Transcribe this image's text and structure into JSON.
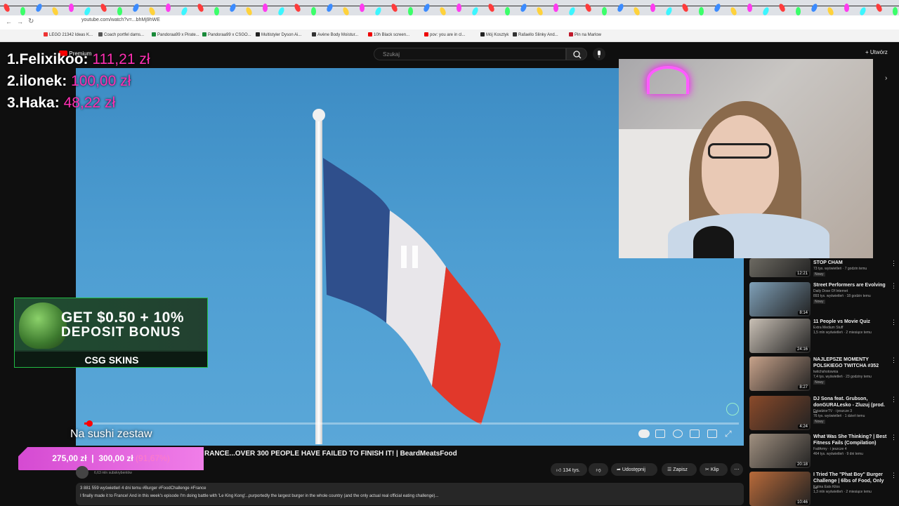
{
  "browser": {
    "url": "youtube.com/watch?v=...bhMj9hWE",
    "bookmarks": [
      {
        "label": "LEGO 21342 Ideas K...",
        "color": "#e33"
      },
      {
        "label": "Coach portfel dams...",
        "color": "#555"
      },
      {
        "label": "Pandoraa99 x Pirate...",
        "color": "#1a8a3a"
      },
      {
        "label": "Pandoraa99 x CSGO...",
        "color": "#1a8a3a"
      },
      {
        "label": "Multistyler Dyson Ai...",
        "color": "#222"
      },
      {
        "label": "Avène Body Moistur...",
        "color": "#333"
      },
      {
        "label": "10h Black screen...",
        "color": "#e00"
      },
      {
        "label": "pov: you are in cl...",
        "color": "#e00"
      },
      {
        "label": "Mój Kosztyk",
        "color": "#222"
      },
      {
        "label": "Rafaello Slinky And...",
        "color": "#333"
      },
      {
        "label": "Pin na Marlow",
        "color": "#c0182a"
      }
    ]
  },
  "youtube": {
    "logo_badge": "Premium",
    "search_placeholder": "Szukaj",
    "create_label": "Utwórz"
  },
  "leaderboard": [
    {
      "rank": "1.",
      "name": "Felixikoo:",
      "amount": "111,21 zł"
    },
    {
      "rank": "2.",
      "name": "ilonek:",
      "amount": "100,00 zł"
    },
    {
      "rank": "3.",
      "name": "Haka:",
      "amount": "48,22 zł"
    }
  ],
  "player": {
    "chapter_text": "Na sushi zestaw",
    "progress_fraction": 0.01
  },
  "ad": {
    "line1": "GET $0.50 + 10%",
    "line2": "DEPOSIT BONUS",
    "brand": "CSG SKINS"
  },
  "donation_goal": {
    "current": "275,00 zł",
    "target": "300,00 zł",
    "percent": "(91,67%)"
  },
  "video": {
    "title": "RANCE...OVER 300 PEOPLE HAVE FAILED TO FINISH IT! | BeardMeatsFood",
    "subscribers": "6,63 mln subskrybentów",
    "likes": "134 tys.",
    "share_label": "Udostępnij",
    "save_label": "Zapisz",
    "clip_label": "Klip",
    "description_meta": "3 881 559 wyświetleń  4 dni temu  #Burger #FoodChallenge #France",
    "description_body": "I finally made it to France! And in this week's episode I'm doing battle with 'Le King Kong'...purportedly the largest burger in the whole country (and the only actual real official eating challenge)..."
  },
  "sidebar": {
    "items": [
      {
        "title": "STOP CHAM",
        "channel": "",
        "meta": "73 tys. wyświetleń · 7 godzin temu",
        "badge": "Nowy",
        "duration": "12:21",
        "thumb_color": "#6d6a62"
      },
      {
        "title": "Street Performers are Evolving",
        "channel": "Daily Dose Of Internet",
        "meta": "893 tys. wyświetleń · 18 godzin temu",
        "badge": "Nowy",
        "duration": "8:14",
        "thumb_color": "#7fa0b8"
      },
      {
        "title": "11 People vs Movie Quiz",
        "channel": "Extra Medium Stuff",
        "meta": "1,5 mln wyświetleń · 2 miesiące temu",
        "badge": "",
        "duration": "24:16",
        "thumb_color": "#c9c0b5"
      },
      {
        "title": "NAJLEPSZE MOMENTY POLSKIEGO TWITCHA #352",
        "channel": "twitchshotownia",
        "meta": "7,4 tys. wyświetleń · 23 godziny temu",
        "badge": "Nowy",
        "duration": "8:27",
        "thumb_color": "#c7a28a"
      },
      {
        "title": "DJ Sona feat. Grubson, donGURALesko - Zluzuj (prod. ...",
        "channel": "DziadziorTV · i jeszcze 3",
        "meta": "76 tys. wyświetleń · 1 dzień temu",
        "badge": "Nowy",
        "duration": "4:24",
        "thumb_color": "#8a4a2a"
      },
      {
        "title": "What Was She Thinking? | Best Fitness Fails (Compilation)",
        "channel": "FailArmy · i jeszcze 4",
        "meta": "464 tys. wyświetleń · 9 dni temu",
        "badge": "",
        "duration": "20:18",
        "thumb_color": "#a09080"
      },
      {
        "title": "I Tried The \"Phat Boy\" Burger Challenge | 6lbs of Food, Only ...",
        "channel": "Katina Eats Kilos",
        "meta": "1,3 mln wyświetleń · 2 miesiące temu",
        "badge": "",
        "duration": "10:46",
        "thumb_color": "#b86a3a"
      }
    ]
  },
  "colors": {
    "accent_pink": "#ff2fb3",
    "goal_bar": "#e05fdd",
    "progress_red": "#ff0000"
  }
}
